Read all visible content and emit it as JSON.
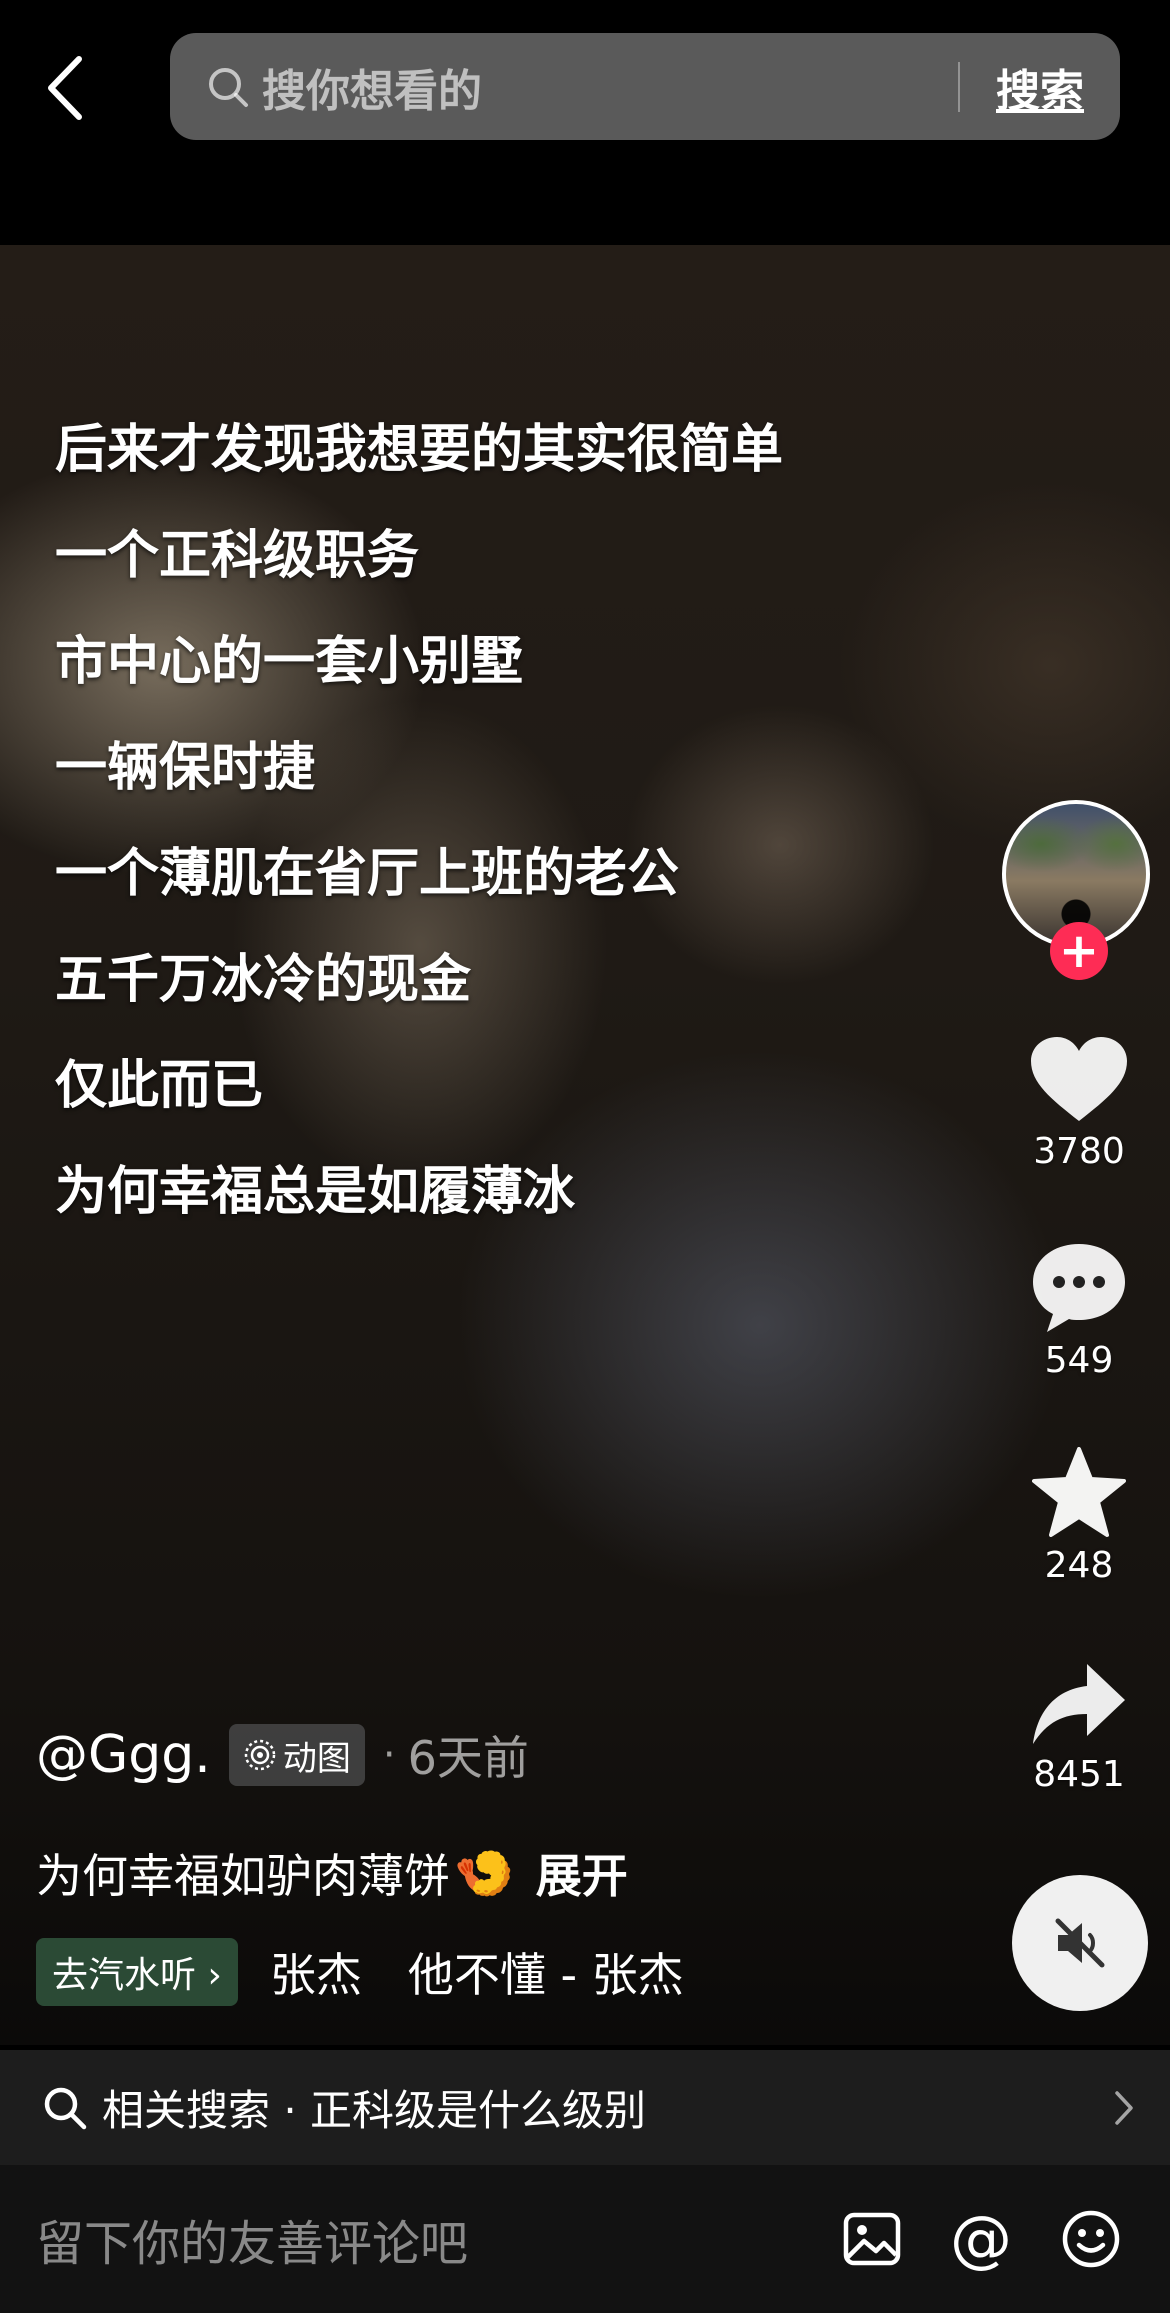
{
  "search": {
    "placeholder": "搜你想看的",
    "button": "搜索"
  },
  "overlay_text": [
    "后来才发现我想要的其实很简单",
    "一个正科级职务",
    "市中心的一套小别墅",
    "一辆保时捷",
    "一个薄肌在省厅上班的老公",
    "五千万冰冷的现金",
    "仅此而已",
    "为何幸福总是如履薄冰"
  ],
  "actions": {
    "like_count": "3780",
    "comment_count": "549",
    "favorite_count": "248",
    "share_count": "8451",
    "follow_symbol": "+"
  },
  "post": {
    "author": "@Ggg.",
    "tag": "动图",
    "dot": "·",
    "time": "6天前",
    "description": "为何幸福如驴肉薄饼",
    "emoji": "🍤",
    "expand": "展开"
  },
  "music": {
    "button": "去汽水听 ›",
    "text": "张杰　他不懂 - 张杰"
  },
  "related": {
    "text": "相关搜索 · 正科级是什么级别"
  },
  "comment": {
    "placeholder": "留下你的友善评论吧"
  },
  "colors": {
    "accent": "#fe2c55",
    "music_button_bg": "#2b4a35",
    "related_bg": "#1d1d1d"
  },
  "icons": [
    "back-icon",
    "search-icon",
    "heart-icon",
    "comment-icon",
    "star-icon",
    "share-icon",
    "mute-icon",
    "chevron-right-icon",
    "image-icon",
    "mention-icon",
    "emoji-icon"
  ]
}
